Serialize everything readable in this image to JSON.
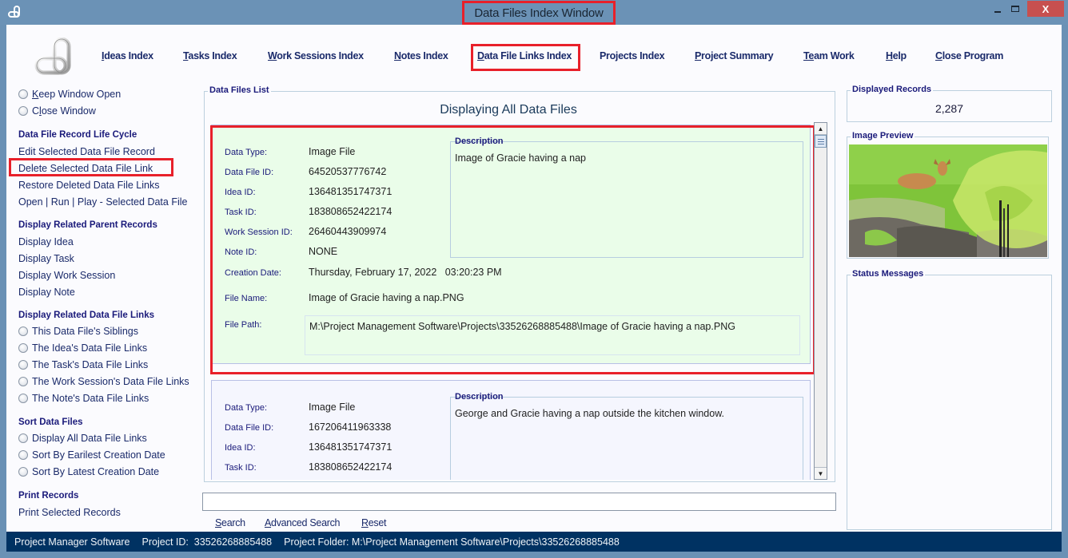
{
  "window": {
    "title": "Data Files Index Window",
    "minimize_icon": "minimize-icon",
    "maximize_icon": "maximize-icon",
    "close_icon": "close-icon",
    "close_glyph": "X",
    "highlight_color": "#e8202a"
  },
  "nav": {
    "items": [
      {
        "key": "I",
        "rest": "deas Index"
      },
      {
        "key": "T",
        "rest": "asks Index"
      },
      {
        "key": "W",
        "rest": "ork Sessions Index"
      },
      {
        "key": "N",
        "rest": "otes Index"
      },
      {
        "key": "D",
        "rest": "ata File Links Index"
      },
      {
        "key": "",
        "rest": "Projects Index"
      },
      {
        "key": "P",
        "rest": "roject Summary"
      },
      {
        "key": "Te",
        "rest": "am Work"
      },
      {
        "key": "H",
        "rest": "elp"
      },
      {
        "key": "C",
        "rest": "lose Program"
      }
    ]
  },
  "sidebar": {
    "window_options": [
      {
        "key": "K",
        "rest": "eep Window Open"
      },
      {
        "pre": "C",
        "key": "l",
        "rest": "ose Window"
      }
    ],
    "lifecycle": {
      "heading": "Data File Record Life Cycle",
      "items": [
        "Edit Selected Data File Record",
        "Delete Selected Data File Link",
        "Restore Deleted Data File Links",
        "Open | Run | Play - Selected Data File"
      ]
    },
    "parents": {
      "heading": "Display Related Parent Records",
      "items": [
        "Display Idea",
        "Display Task",
        "Display Work Session",
        "Display Note"
      ]
    },
    "related": {
      "heading": "Display Related Data File Links",
      "items": [
        "This Data File's Siblings",
        "The Idea's Data File Links",
        "The Task's Data File Links",
        "The Work Session's Data File Links",
        "The Note's Data File Links"
      ]
    },
    "sort": {
      "heading": "Sort Data Files",
      "items": [
        "Display All Data File Links",
        "Sort By Earilest Creation Date",
        "Sort By Latest Creation Date"
      ]
    },
    "print": {
      "heading": "Print Records",
      "items": [
        "Print Selected Records"
      ]
    }
  },
  "list": {
    "group_label": "Data Files List",
    "heading": "Displaying All Data Files",
    "labels": {
      "data_type": "Data Type:",
      "data_file_id": "Data File ID:",
      "idea_id": "Idea ID:",
      "task_id": "Task ID:",
      "work_session_id": "Work Session ID:",
      "note_id": "Note ID:",
      "creation_date": "Creation Date:",
      "file_name": "File Name:",
      "file_path": "File Path:",
      "description": "Description"
    },
    "records": [
      {
        "selected": true,
        "data_type": "Image File",
        "data_file_id": "64520537776742",
        "idea_id": "136481351747371",
        "task_id": "183808652422174",
        "work_session_id": "26460443909974",
        "note_id": "NONE",
        "creation_date": "Thursday, February 17, 2022   03:20:23 PM",
        "file_name": "Image of Gracie having a nap.PNG",
        "file_path": "M:\\Project Management Software\\Projects\\33526268885488\\Image of Gracie having a nap.PNG",
        "description": "Image of Gracie having a nap"
      },
      {
        "selected": false,
        "data_type": "Image File",
        "data_file_id": "167206411963338",
        "idea_id": "136481351747371",
        "task_id": "183808652422174",
        "description": "George and Gracie having a nap outside the kitchen window."
      }
    ]
  },
  "search": {
    "value": "",
    "buttons": [
      {
        "key": "S",
        "rest": "earch"
      },
      {
        "key": "A",
        "rest": "dvanced Search"
      },
      {
        "key": "R",
        "rest": "eset"
      }
    ]
  },
  "right": {
    "displayed_records_label": "Displayed Records",
    "displayed_records_value": "2,287",
    "image_preview_label": "Image Preview",
    "image_preview_subject": "deer-resting-in-grass-photo",
    "status_messages_label": "Status Messages"
  },
  "statusbar": {
    "app_name": "Project Manager Software",
    "project_id": "Project ID:  33526268885488",
    "project_folder": "Project Folder: M:\\Project Management Software\\Projects\\33526268885488"
  }
}
